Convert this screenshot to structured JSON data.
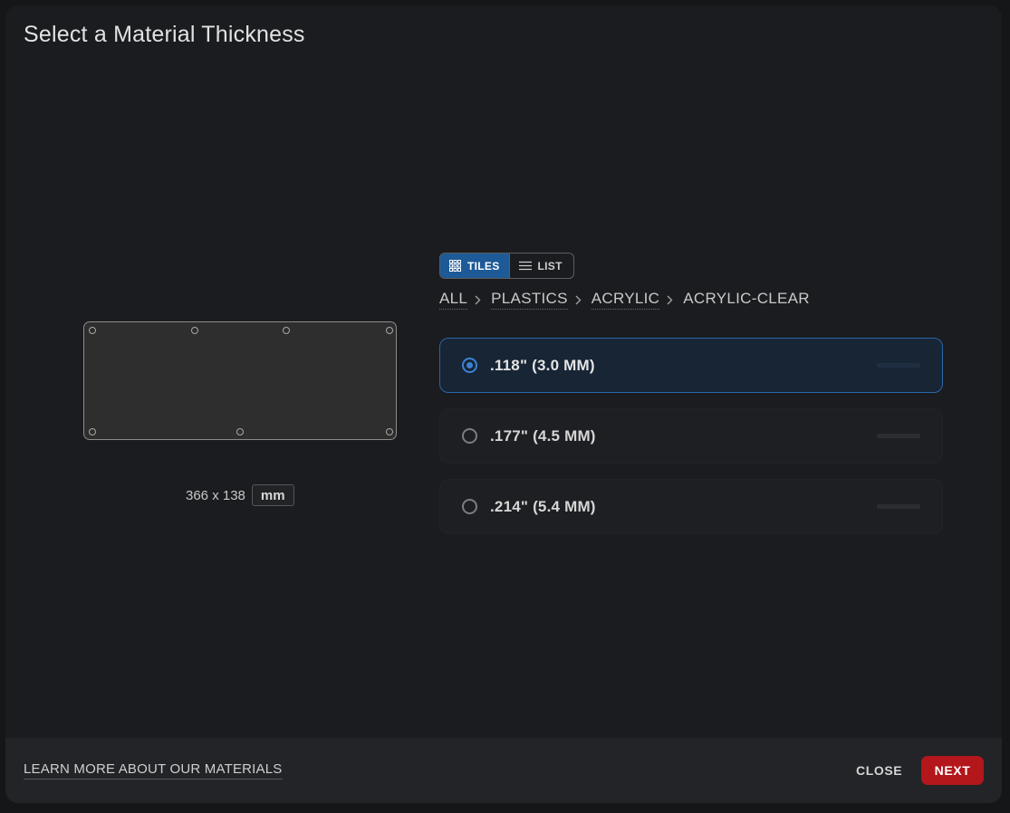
{
  "dialog": {
    "title": "Select a Material Thickness"
  },
  "preview": {
    "width": "366",
    "height": "138",
    "dims_text": "366 x 138",
    "unit": "mm"
  },
  "view_toggle": {
    "tiles_label": "TILES",
    "list_label": "LIST",
    "active": "TILES",
    "tiles_icon": "grid-icon",
    "list_icon": "list-icon"
  },
  "breadcrumb": {
    "items": [
      "ALL",
      "PLASTICS",
      "ACRYLIC"
    ],
    "current": "ACRYLIC-CLEAR",
    "separator_icon": "chevron-right-icon"
  },
  "options": [
    {
      "label": ".118\" (3.0 MM)",
      "selected": true
    },
    {
      "label": ".177\" (4.5 MM)",
      "selected": false
    },
    {
      "label": ".214\" (5.4 MM)",
      "selected": false
    }
  ],
  "footer": {
    "learn_more": "LEARN MORE ABOUT OUR MATERIALS",
    "close_label": "CLOSE",
    "next_label": "NEXT"
  },
  "colors": {
    "accent_blue": "#1d5a97",
    "selected_border": "#2a66a8",
    "next_button": "#b3161b",
    "modal_bg": "#1b1c1f"
  }
}
